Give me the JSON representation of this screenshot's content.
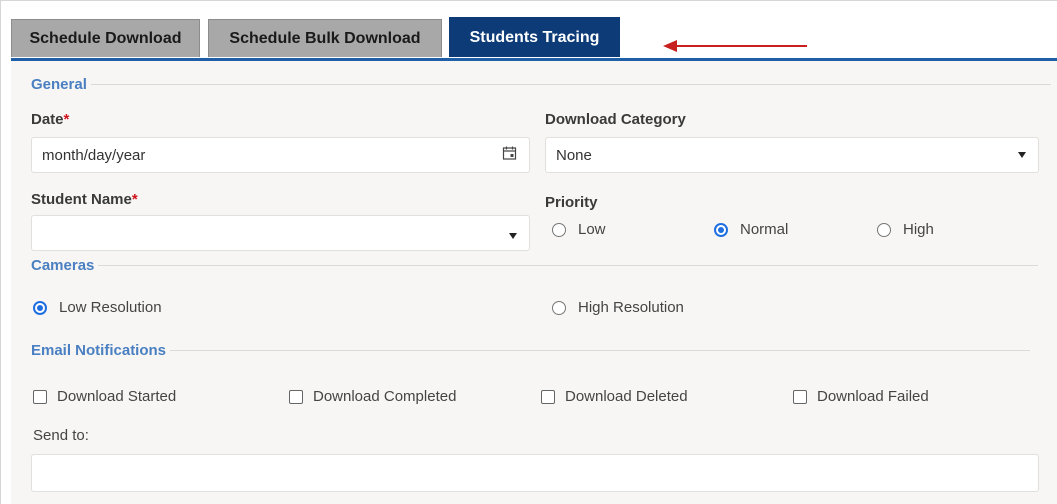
{
  "tabs": [
    {
      "label": "Schedule Download",
      "active": false
    },
    {
      "label": "Schedule Bulk Download",
      "active": false
    },
    {
      "label": "Students Tracing",
      "active": true
    }
  ],
  "annotation": {
    "arrow_color": "#c8201e"
  },
  "general": {
    "title": "General",
    "date_label": "Date",
    "date_placeholder": "month/day/year",
    "required_mark": "*",
    "category_label": "Download Category",
    "category_value": "None",
    "student_label": "Student Name",
    "student_value": "",
    "priority_label": "Priority",
    "priority_options": [
      "Low",
      "Normal",
      "High"
    ],
    "priority_selected": "Normal"
  },
  "cameras": {
    "title": "Cameras",
    "options": [
      "Low Resolution",
      "High Resolution"
    ],
    "selected": "Low Resolution"
  },
  "email": {
    "title": "Email Notifications",
    "checks": [
      "Download Started",
      "Download Completed",
      "Download Deleted",
      "Download Failed"
    ],
    "send_to_label": "Send to:",
    "send_to_value": ""
  },
  "colors": {
    "accent": "#1f5fa8",
    "active_tab": "#0d3b78",
    "section_title": "#4a7fc1",
    "required": "#d0121b"
  }
}
